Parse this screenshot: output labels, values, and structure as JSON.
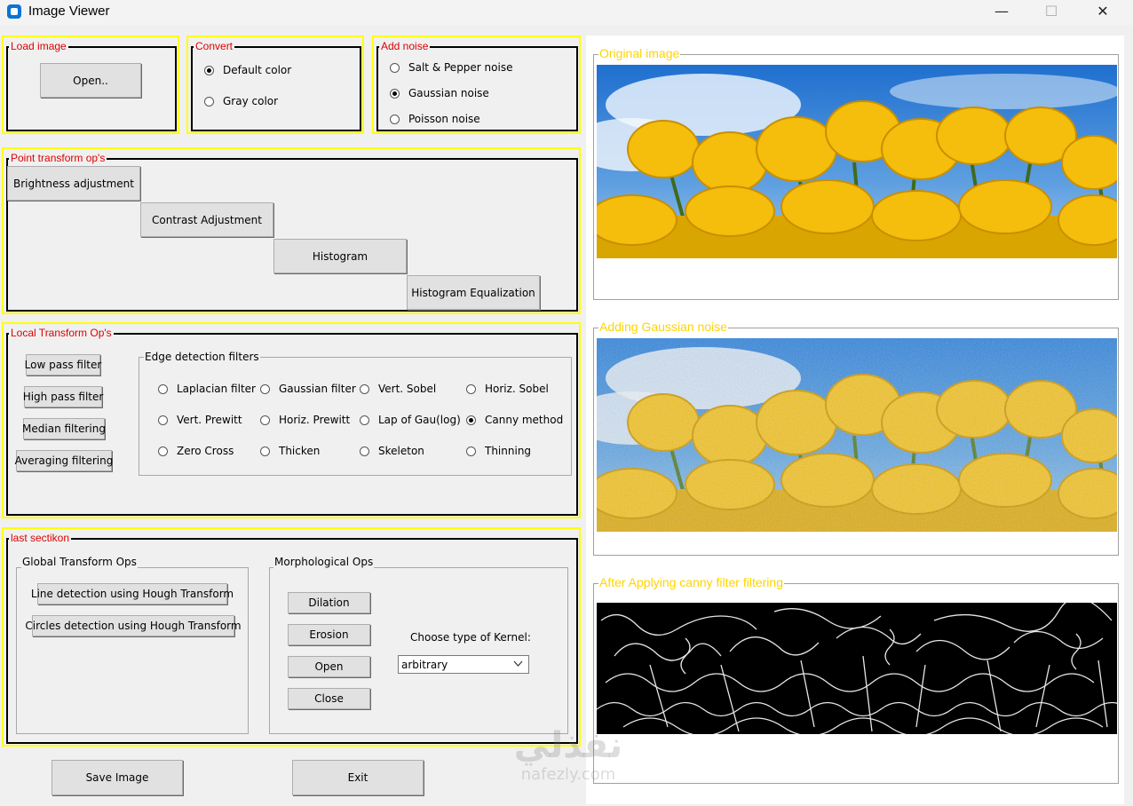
{
  "window": {
    "title": "Image Viewer",
    "minimize": "—",
    "maximize": "☐",
    "close": "✕"
  },
  "load_image": {
    "label": "Load image",
    "open_button": "Open.."
  },
  "convert": {
    "label": "Convert",
    "options": [
      "Default color",
      "Gray color"
    ],
    "selected": "Default color"
  },
  "add_noise": {
    "label": "Add noise",
    "options": [
      "Salt & Pepper noise",
      "Gaussian noise",
      "Poisson noise"
    ],
    "selected": "Gaussian noise"
  },
  "point_transform": {
    "label": "Point transform op's",
    "buttons": [
      "Brightness adjustment",
      "Contrast Adjustment",
      "Histogram",
      "Histogram Equalization"
    ]
  },
  "local_transform": {
    "label": "Local Transform Op's",
    "buttons": [
      "Low pass filter",
      "High pass filter",
      "Median filtering",
      "Averaging filtering"
    ],
    "edge_detection": {
      "label": "Edge detection filters",
      "options": [
        "Laplacian filter",
        "Gaussian filter",
        "Vert. Sobel",
        "Horiz. Sobel",
        "Vert. Prewitt",
        "Horiz. Prewitt",
        "Lap of Gau(log)",
        "Canny method",
        "Zero Cross",
        "Thicken",
        "Skeleton",
        "Thinning"
      ],
      "selected": "Canny method"
    }
  },
  "last_section": {
    "label": "last sectikon",
    "global": {
      "label": "Global Transform Ops",
      "buttons": [
        "Line detection using Hough Transform",
        "Circles detection using Hough Transform"
      ]
    },
    "morph": {
      "label": "Morphological Ops",
      "buttons": [
        "Dilation",
        "Erosion",
        "Open",
        "Close"
      ],
      "kernel_label": "Choose type of Kernel:",
      "kernel_value": "arbitrary"
    }
  },
  "bottom": {
    "save": "Save Image",
    "exit": "Exit"
  },
  "images": {
    "original": "Original image",
    "noisy": "Adding Gaussian noise",
    "filtered": "After Applying canny filter filtering"
  },
  "watermark": {
    "arabic": "نفذلي",
    "latin": "nafezly.com"
  },
  "colors": {
    "frame_yellow": "#ffff00",
    "label_red": "#e00000",
    "image_label_yellow": "#ffd400"
  }
}
